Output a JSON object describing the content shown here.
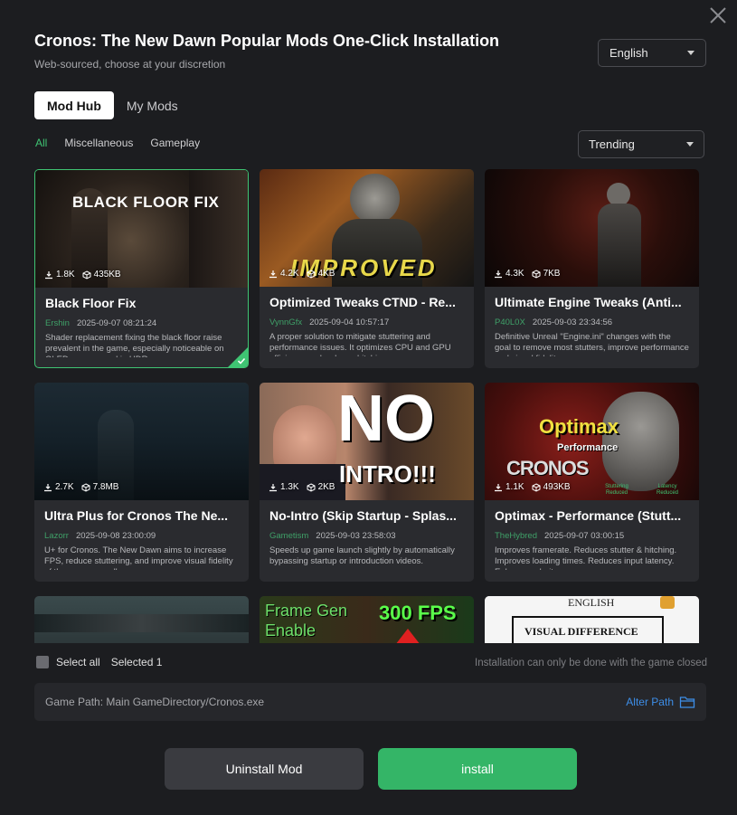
{
  "header": {
    "title": "Cronos: The New Dawn Popular Mods One-Click Installation",
    "subtitle": "Web-sourced, choose at your discretion"
  },
  "language": {
    "selected": "English"
  },
  "tabs": [
    {
      "label": "Mod Hub",
      "active": true
    },
    {
      "label": "My Mods",
      "active": false
    }
  ],
  "categories": [
    {
      "label": "All",
      "active": true
    },
    {
      "label": "Miscellaneous",
      "active": false
    },
    {
      "label": "Gameplay",
      "active": false
    }
  ],
  "sort": {
    "selected": "Trending"
  },
  "mods": [
    {
      "title": "Black Floor Fix",
      "author": "Ershin",
      "date": "2025-09-07 08:21:24",
      "downloads": "1.8K",
      "size": "435KB",
      "desc": "Shader replacement fixing the black floor raise prevalent in the game, especially noticeable on OLED screens and in HDR.",
      "overlay": "BLACK FLOOR FIX",
      "selected": true
    },
    {
      "title": "Optimized Tweaks CTND - Re...",
      "author": "VynnGfx",
      "date": "2025-09-04 10:57:17",
      "downloads": "4.2K",
      "size": "4KB",
      "desc": "A proper solution to mitigate stuttering and performance issues. It optimizes CPU and GPU efficiency and reduces hitching.",
      "overlay": "IMPROVED",
      "selected": false
    },
    {
      "title": "Ultimate Engine Tweaks (Anti...",
      "author": "P40L0X",
      "date": "2025-09-03 23:34:56",
      "downloads": "4.3K",
      "size": "7KB",
      "desc": "Definitive Unreal \"Engine.ini\" changes with the goal to remove most stutters, improve performance and visual fidelity.",
      "overlay": "",
      "selected": false
    },
    {
      "title": "Ultra Plus for Cronos The Ne...",
      "author": "Lazorr",
      "date": "2025-09-08 23:00:09",
      "downloads": "2.7K",
      "size": "7.8MB",
      "desc": "U+ for Cronos. The New Dawn aims to increase FPS, reduce stuttering, and improve visual fidelity of the game overall.",
      "overlay": "",
      "selected": false
    },
    {
      "title": "No-Intro (Skip Startup - Splas...",
      "author": "Gametism",
      "date": "2025-09-03 23:58:03",
      "downloads": "1.3K",
      "size": "2KB",
      "desc": "Speeds up game launch slightly by automatically bypassing startup or introduction videos.",
      "overlay": "NO",
      "overlay2": "INTRO!!!",
      "selected": false
    },
    {
      "title": "Optimax - Performance (Stutt...",
      "author": "TheHybred",
      "date": "2025-09-07 03:00:15",
      "downloads": "1.1K",
      "size": "493KB",
      "desc": "Improves framerate. Reduces stutter & hitching. Improves loading times. Reduces input latency. Enhances clarity.",
      "overlay": "Optimax",
      "overlay2": "Performance",
      "overlay3": "CRONOS",
      "overlay4": "Stuttering Reduced",
      "overlay5": "Latency Reduced",
      "selected": false
    },
    {
      "title": "",
      "author": "",
      "date": "",
      "downloads": "",
      "size": "",
      "desc": "",
      "overlay": "",
      "selected": false
    },
    {
      "title": "",
      "author": "",
      "date": "",
      "downloads": "",
      "size": "",
      "desc": "",
      "overlay": "Frame Gen",
      "overlay2": "Enable",
      "overlay3": "300 FPS",
      "selected": false
    },
    {
      "title": "",
      "author": "",
      "date": "",
      "downloads": "",
      "size": "",
      "desc": "",
      "overlay": "ENGLISH",
      "overlay2": "VISUAL DIFFERENCE",
      "selected": false
    }
  ],
  "footer": {
    "select_all_label": "Select all",
    "selected_text": "Selected 1",
    "install_note": "Installation can only be done with the game closed",
    "game_path": "Game Path: Main GameDirectory/Cronos.exe",
    "alter_path_label": "Alter Path",
    "uninstall_label": "Uninstall Mod",
    "install_label": "install"
  },
  "colors": {
    "accent": "#3fc473",
    "install": "#34b567",
    "link": "#3d8ee8"
  }
}
